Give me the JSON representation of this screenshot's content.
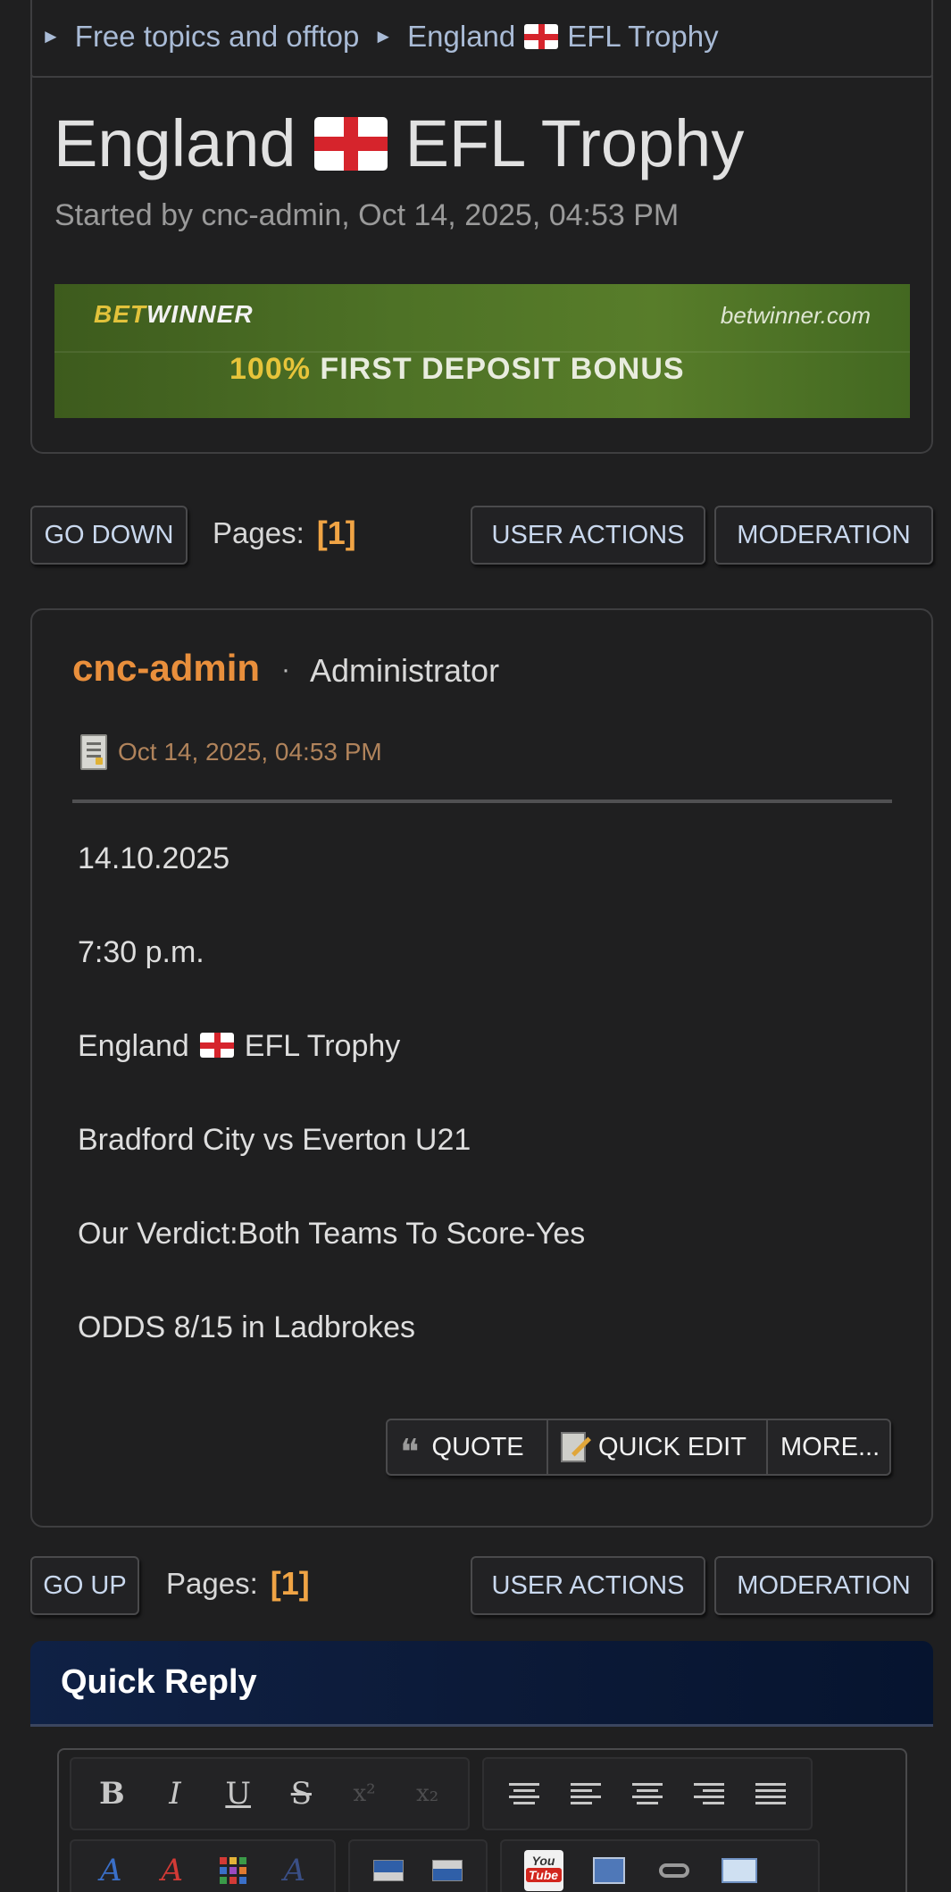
{
  "breadcrumb": {
    "items": [
      {
        "label": "Free topics and offtop"
      },
      {
        "label": "England",
        "label_suffix": "EFL Trophy"
      }
    ]
  },
  "topic": {
    "title_prefix": "England",
    "title_suffix": "EFL Trophy",
    "started_by": "Started by cnc-admin, Oct 14, 2025, 04:53 PM"
  },
  "banner": {
    "brand_left": "BET",
    "brand_right": "WINNER",
    "site": "betwinner.com",
    "bonus_highlight": "100%",
    "bonus_text": "FIRST DEPOSIT BONUS"
  },
  "nav_top": {
    "go_down": "GO DOWN",
    "pages_label": "Pages:",
    "current_page": "[1]",
    "user_actions": "USER ACTIONS",
    "moderation": "MODERATION"
  },
  "post": {
    "author": "cnc-admin",
    "separator": "·",
    "role": "Administrator",
    "date": "Oct 14, 2025, 04:53 PM",
    "lines": [
      "14.10.2025",
      "7:30 p.m.",
      "England",
      "Bradford City vs Everton U21",
      "Our Verdict:Both Teams To Score-Yes",
      "ODDS 8/15 in Ladbrokes"
    ],
    "line3_suffix": "EFL Trophy",
    "actions": {
      "quote": "QUOTE",
      "quick_edit": "QUICK EDIT",
      "more": "MORE..."
    }
  },
  "nav_bottom": {
    "go_up": "GO UP",
    "pages_label": "Pages:",
    "current_page": "[1]",
    "user_actions": "USER ACTIONS",
    "moderation": "MODERATION"
  },
  "quick_reply": {
    "title": "Quick Reply",
    "toolbar_row1": [
      "B",
      "I",
      "U",
      "S",
      "x²",
      "x₂"
    ],
    "youtube_text_top": "You",
    "youtube_text_bottom": "Tube"
  },
  "colors": {
    "background": "#1f1f20",
    "link": "#a9bbd6",
    "author": "#e98f3c",
    "page_number": "#f0a445",
    "quick_reply_header": "#0c1a38"
  }
}
